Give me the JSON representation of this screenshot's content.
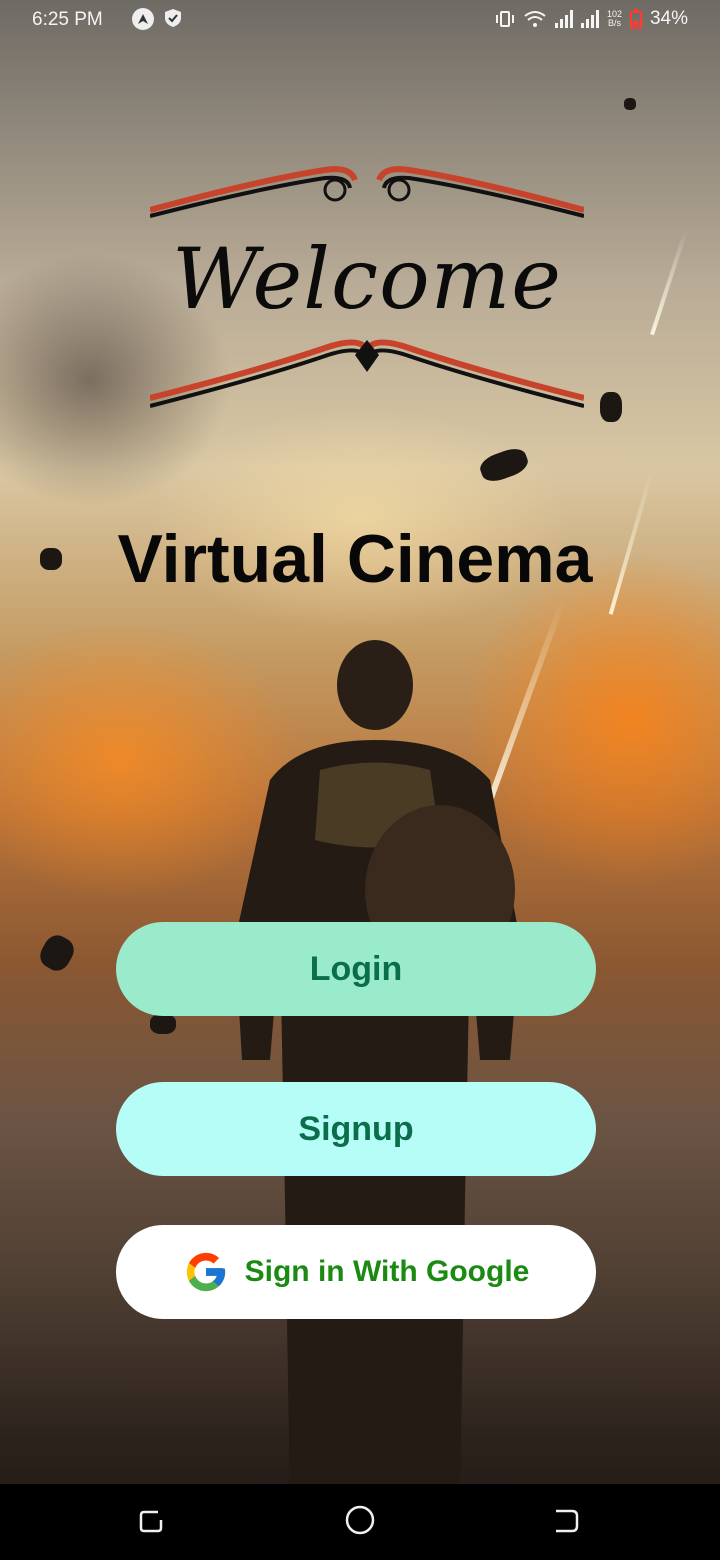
{
  "status_bar": {
    "time": "6:25 PM",
    "net_speed_value": "102",
    "net_speed_unit": "B/s",
    "battery": "34%"
  },
  "welcome": {
    "text": "Welcome"
  },
  "app": {
    "title": "Virtual Cinema"
  },
  "buttons": {
    "login": "Login",
    "signup": "Signup",
    "google": "Sign in With Google"
  },
  "colors": {
    "login_bg": "#99ebcc",
    "signup_bg": "#b6fdf8",
    "button_text": "#0a6e4a",
    "google_text": "#1b8a12"
  },
  "icons": {
    "status_left": [
      "navigation-icon",
      "shield-icon"
    ],
    "status_right": [
      "vibrate-icon",
      "wifi-icon",
      "signal-icon",
      "signal-icon",
      "battery-icon"
    ],
    "navigation": [
      "recent-apps-icon",
      "home-icon",
      "back-icon"
    ]
  }
}
